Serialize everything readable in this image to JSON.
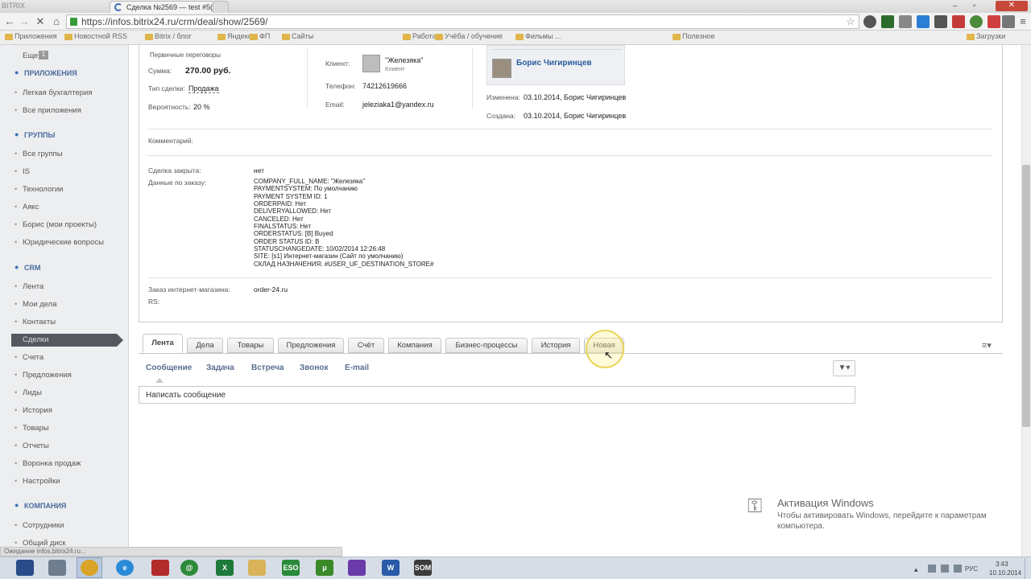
{
  "browser": {
    "tabs": [
      {
        "label": "Сделка №2569 — test #5(",
        "active": true
      },
      {
        "label": "",
        "active": false
      }
    ],
    "window_title": "BITRIX",
    "url": "https://infos.bitrix24.ru/crm/deal/show/2569/",
    "bookmarks": [
      "Приложения",
      "Новостной RSS",
      "Bitrix / блог",
      "Яндекс",
      "ФП",
      "Сайты",
      "Работа",
      "Учёба / обучение",
      "Фильмы ...",
      "Полезное",
      "Загрузки"
    ]
  },
  "sidebar": {
    "top_item": "Еще",
    "top_badge": "1",
    "sections": [
      {
        "title": "ПРИЛОЖЕНИЯ",
        "items": [
          "Легкая бухгалтерия",
          "Все приложения"
        ]
      },
      {
        "title": "ГРУППЫ",
        "items": [
          "Все группы",
          "IS",
          "Технологии",
          "Аякс",
          "Борис (мои проекты)",
          "Юридические вопросы"
        ]
      },
      {
        "title": "CRM",
        "items": [
          "Лента",
          "Мои дела",
          "Контакты",
          "Сделки",
          "Счета",
          "Предложения",
          "Лиды",
          "История",
          "Товары",
          "Отчеты",
          "Воронка продаж",
          "Настройки"
        ]
      },
      {
        "title": "КОМПАНИЯ",
        "items": [
          "Сотрудники",
          "Общий диск"
        ]
      }
    ],
    "active_item": "Сделки"
  },
  "deal": {
    "stage_note": "Первичные переговоры",
    "sum_label": "Сумма:",
    "sum_value": "270.00 руб.",
    "type_label": "Тип сделки:",
    "type_value": "Продажа",
    "prob_label": "Вероятность:",
    "prob_value": "20 %",
    "client_label": "Клиент:",
    "client_name": "\"Железяка\"",
    "client_role": "Клиент",
    "phone_label": "Телефон:",
    "phone_value": "74212619666",
    "email_label": "Email:",
    "email_value": "jeleziaka1@yandex.ru",
    "responsible_name": "Борис Чигиринцев",
    "changed_label": "Изменена:",
    "changed_value": "03.10.2014, Борис Чигиринцев",
    "created_label": "Создана:",
    "created_value": "03.10.2014, Борис Чигиринцев",
    "comment_label": "Комментарий:",
    "closed_label": "Сделка закрыта:",
    "closed_value": "нет",
    "order_data_label": "Данные по заказу:",
    "order_data_lines": [
      "COMPANY_FULL_NAME: \"Железяка\"",
      "PAYMENTSYSTEM: По умолчанию",
      "PAYMENT SYSTEM ID: 1",
      "ORDERPAID: Нет",
      "DELIVERYALLOWED: Нет",
      "CANCELED: Нет",
      "FINALSTATUS: Нет",
      "ORDERSTATUS: [B] Buyed",
      "ORDER STATUS ID: B",
      "STATUSCHANGEDATE: 10/02/2014 12:26:48",
      "SITE: [s1] Интернет-магазин (Сайт по умолчанию)",
      "СКЛАД НАЗНАЧЕНИЯ: #USER_UF_DESTINATION_STORE#"
    ],
    "shop_order_label": "Заказ интернет-магазина:",
    "shop_order_value": "order-24.ru",
    "rs_label": "RS:"
  },
  "tabs": [
    "Лента",
    "Дела",
    "Товары",
    "Предложения",
    "Счёт",
    "Компания",
    "Бизнес-процессы",
    "История",
    "Новая"
  ],
  "feed": {
    "subtabs": [
      "Сообщение",
      "Задача",
      "Встреча",
      "Звонок",
      "E-mail"
    ],
    "message_placeholder": "Написать сообщение"
  },
  "windows_activation": {
    "title": "Активация Windows",
    "line1": "Чтобы активировать Windows, перейдите к параметрам",
    "line2": "компьютера."
  },
  "statusbar": "Ожидание infos.bitrix24.ru...",
  "taskbar": {
    "lang": "РУС",
    "time": "3:43",
    "date": "10.10.2014",
    "apps": [
      "save",
      "calculator",
      "chrome",
      "ie",
      "filezilla",
      "mail",
      "excel",
      "folder",
      "eso",
      "utorrent",
      "visual-studio",
      "word",
      "som"
    ]
  },
  "colors": {
    "accent": "#3b6fb6",
    "sidebar_bg": "#edeef0",
    "active_item_bg": "#55595f",
    "link": "#2a5b9e"
  }
}
